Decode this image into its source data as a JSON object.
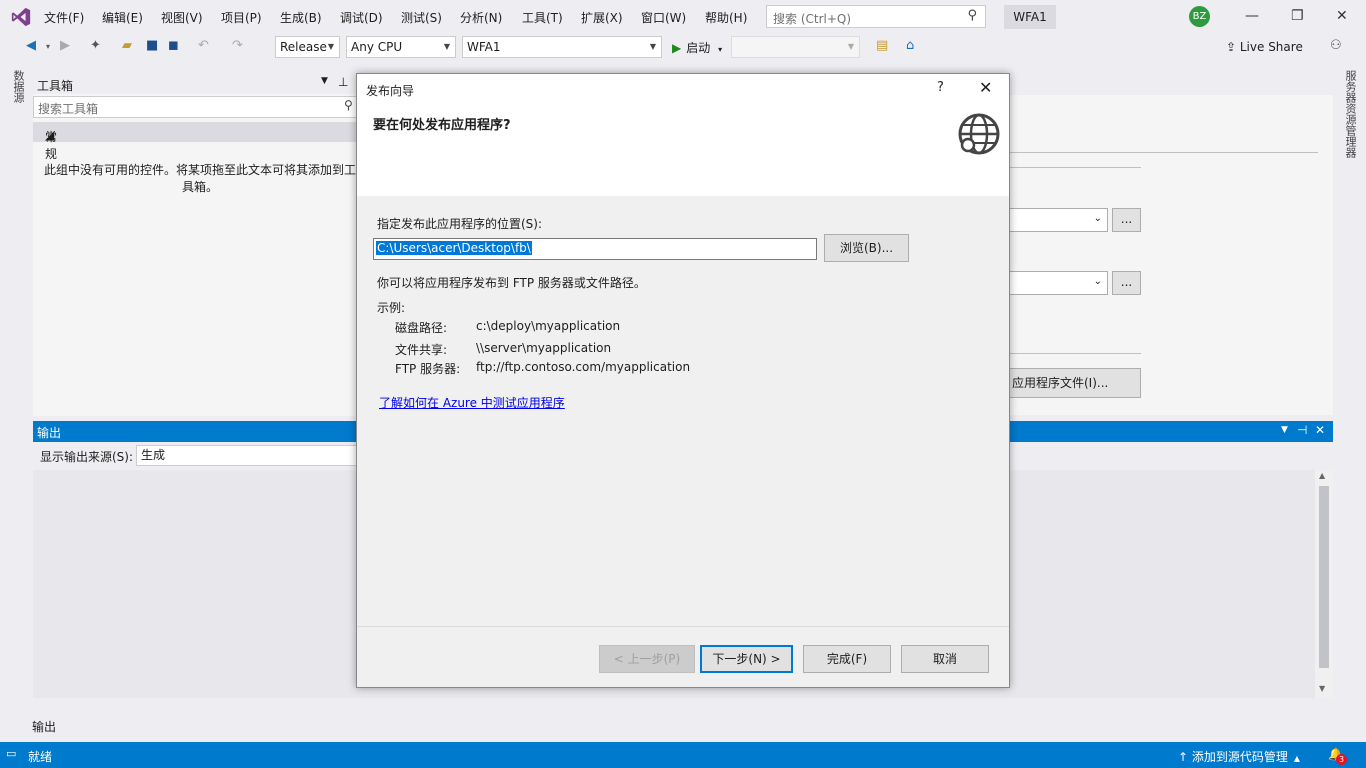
{
  "menu": {
    "items": [
      "文件(F)",
      "编辑(E)",
      "视图(V)",
      "项目(P)",
      "生成(B)",
      "调试(D)",
      "测试(S)",
      "分析(N)",
      "工具(T)",
      "扩展(X)",
      "窗口(W)",
      "帮助(H)"
    ],
    "search_placeholder": "搜索 (Ctrl+Q)",
    "project_name": "WFA1",
    "avatar_initials": "BZ"
  },
  "toolbar": {
    "config": "Release",
    "platform": "Any CPU",
    "startup_project": "WFA1",
    "start_label": "启动",
    "live_share": "Live Share"
  },
  "side_rails": {
    "left": "数据源",
    "right": "服务器资源管理器"
  },
  "toolbox": {
    "title": "工具箱",
    "search_placeholder": "搜索工具箱",
    "category": "常规",
    "empty_message": "此组中没有可用的控件。将某项拖至此文本可将其添加到工具箱。"
  },
  "doc": {
    "button_label": "应用程序文件(I)...",
    "ellipsis": "..."
  },
  "output": {
    "title": "输出",
    "source_label": "显示输出来源(S):",
    "source_value": "生成",
    "tab_label": "输出"
  },
  "status": {
    "ready": "就绪",
    "source_control": "添加到源代码管理",
    "notifications": "3"
  },
  "dialog": {
    "title": "发布向导",
    "help": "?",
    "heading": "要在何处发布应用程序?",
    "location_label": "指定发布此应用程序的位置(S):",
    "location_value": "C:\\Users\\acer\\Desktop\\fb\\",
    "browse": "浏览(B)...",
    "info": "你可以将应用程序发布到 FTP 服务器或文件路径。",
    "examples_label": "示例:",
    "examples": [
      {
        "label": "磁盘路径:",
        "value": "c:\\deploy\\myapplication"
      },
      {
        "label": "文件共享:",
        "value": "\\\\server\\myapplication"
      },
      {
        "label": "FTP 服务器:",
        "value": "ftp://ftp.contoso.com/myapplication"
      }
    ],
    "azure_link": "了解如何在 Azure 中测试应用程序",
    "buttons": {
      "prev": "< 上一步(P)",
      "next": "下一步(N) >",
      "finish": "完成(F)",
      "cancel": "取消"
    }
  },
  "colors": {
    "accent": "#007acc",
    "link": "#0000ee",
    "selection": "#0078d7"
  }
}
